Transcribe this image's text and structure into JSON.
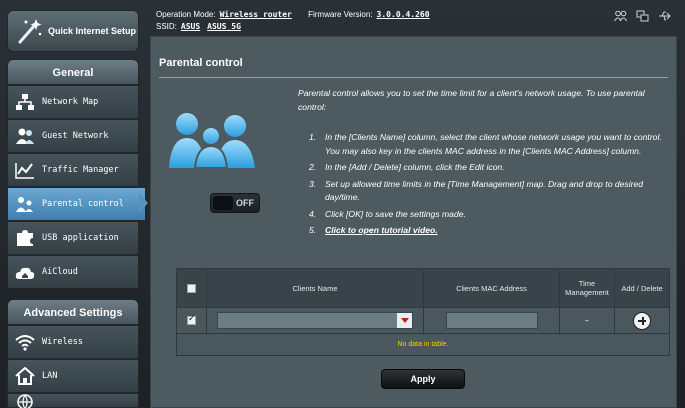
{
  "sidebar": {
    "quick_setup": "Quick Internet Setup",
    "general_title": "General",
    "items": [
      {
        "label": "Network Map"
      },
      {
        "label": "Guest Network"
      },
      {
        "label": "Traffic Manager"
      },
      {
        "label": "Parental control"
      },
      {
        "label": "USB application"
      },
      {
        "label": "AiCloud"
      }
    ],
    "advanced_title": "Advanced Settings",
    "adv_items": [
      {
        "label": "Wireless"
      },
      {
        "label": "LAN"
      }
    ]
  },
  "header": {
    "op_mode_label": "Operation Mode:",
    "op_mode_value": "Wireless router",
    "fw_label": "Firmware Version:",
    "fw_value": "3.0.0.4.260",
    "ssid_label": "SSID:",
    "ssid_1": "ASUS",
    "ssid_2": "ASUS_5G"
  },
  "main": {
    "title": "Parental control",
    "description": "Parental control allows you to set the time limit for a client's network usage. To use parental control:",
    "steps": [
      "In the [Clients Name] column, select the client whose network usage you want to control. You may also key in the clients MAC address in the [Clients MAC Address] column.",
      "In the [Add / Delete] column, click the Edit icon.",
      "Set up allowed time limits in the [Time Management] map. Drag and drop to desired day/time.",
      "Click [OK] to save the settings made.",
      "Click to open tutorial video."
    ],
    "toggle_state": "OFF",
    "table": {
      "headers": [
        "Clients Name",
        "Clients MAC Address",
        "Time Management",
        "Add / Delete"
      ],
      "row_time": "–",
      "no_data": "No data in table."
    },
    "apply_label": "Apply"
  }
}
